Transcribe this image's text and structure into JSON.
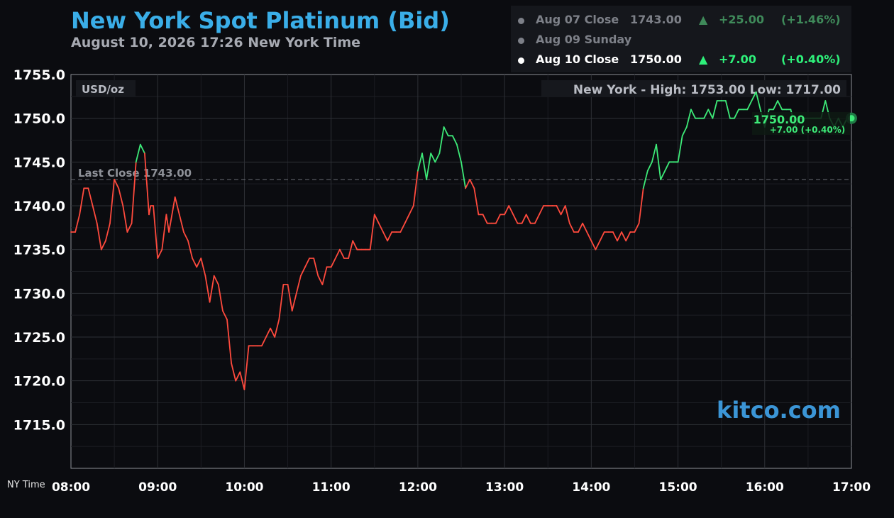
{
  "chart_data": {
    "type": "line",
    "title": "New York Spot Platinum (Bid)",
    "subtitle": "August 10, 2026 17:26 New York Time",
    "unit_label": "USD/oz",
    "stats_label": "New York - High: 1753.00   Low: 1717.00",
    "last_close_label": "Last Close 1743.00",
    "last_close": 1743.0,
    "current_value_label": "1750.00",
    "current_change_label": "+7.00 (+0.40%)",
    "current_value": 1750.0,
    "watermark": "kitco.com",
    "x_axis_caption": "NY Time",
    "xlim": [
      8,
      17
    ],
    "ylim": [
      1710,
      1755
    ],
    "x_ticks": [
      8,
      9,
      10,
      11,
      12,
      13,
      14,
      15,
      16,
      17
    ],
    "x_tick_labels": [
      "08:00",
      "09:00",
      "10:00",
      "11:00",
      "12:00",
      "13:00",
      "14:00",
      "15:00",
      "16:00",
      "17:00"
    ],
    "y_ticks": [
      1715,
      1720,
      1725,
      1730,
      1735,
      1740,
      1745,
      1750,
      1755
    ],
    "y_tick_labels": [
      "1715.0",
      "1720.0",
      "1725.0",
      "1730.0",
      "1735.0",
      "1740.0",
      "1745.0",
      "1750.0",
      "1755.0"
    ],
    "grid": true,
    "colors": {
      "below_close": "#ff4a3d",
      "above_close": "#3dea78",
      "title": "#3aaee8",
      "watermark": "#3b95d6",
      "grid": "#2e3036",
      "frame": "#8c8f96"
    },
    "series": [
      {
        "x": [
          8.0,
          8.05,
          8.1,
          8.15,
          8.2,
          8.25,
          8.3,
          8.35,
          8.4,
          8.45,
          8.5,
          8.55,
          8.6,
          8.65,
          8.7,
          8.75,
          8.8,
          8.85,
          8.9,
          8.92,
          8.95,
          9.0,
          9.05,
          9.1,
          9.13,
          9.2,
          9.25,
          9.3,
          9.35,
          9.4,
          9.45,
          9.5,
          9.55,
          9.6,
          9.65,
          9.7,
          9.75,
          9.8,
          9.85,
          9.9,
          9.95,
          10.0,
          10.05,
          10.1,
          10.15,
          10.2,
          10.25,
          10.3,
          10.35,
          10.4,
          10.45,
          10.5,
          10.55,
          10.6,
          10.65,
          10.7,
          10.75,
          10.8,
          10.85,
          10.9,
          10.95,
          11.0,
          11.05,
          11.1,
          11.15,
          11.2,
          11.25,
          11.3,
          11.35,
          11.4,
          11.45,
          11.5,
          11.55,
          11.6,
          11.65,
          11.7,
          11.75,
          11.8,
          11.85,
          11.9,
          11.95,
          12.0,
          12.05,
          12.1,
          12.15,
          12.2,
          12.25,
          12.3,
          12.35,
          12.4,
          12.45,
          12.5,
          12.55,
          12.6,
          12.65,
          12.7,
          12.75,
          12.8,
          12.85,
          12.9,
          12.95,
          13.0,
          13.05,
          13.1,
          13.15,
          13.2,
          13.25,
          13.3,
          13.35,
          13.4,
          13.45,
          13.5,
          13.55,
          13.6,
          13.65,
          13.7,
          13.75,
          13.8,
          13.85,
          13.9,
          13.95,
          14.0,
          14.05,
          14.1,
          14.15,
          14.2,
          14.25,
          14.3,
          14.35,
          14.4,
          14.45,
          14.5,
          14.55,
          14.6,
          14.65,
          14.7,
          14.75,
          14.8,
          14.85,
          14.9,
          14.95,
          15.0,
          15.05,
          15.1,
          15.15,
          15.2,
          15.25,
          15.3,
          15.35,
          15.4,
          15.45,
          15.5,
          15.55,
          15.6,
          15.65,
          15.7,
          15.75,
          15.8,
          15.85,
          15.9,
          15.95,
          16.0,
          16.05,
          16.1,
          16.15,
          16.2,
          16.25,
          16.3,
          16.35,
          16.4,
          16.45,
          16.5,
          16.55,
          16.6,
          16.65,
          16.7,
          16.75,
          16.8,
          16.85,
          16.9,
          16.95,
          17.0
        ],
        "y": [
          1737,
          1737,
          1739,
          1742,
          1742,
          1740,
          1738,
          1735,
          1736,
          1738,
          1743,
          1742,
          1740,
          1737,
          1738,
          1745,
          1747,
          1746,
          1739,
          1740,
          1740,
          1734,
          1735,
          1739,
          1737,
          1741,
          1739,
          1737,
          1736,
          1734,
          1733,
          1734,
          1732,
          1729,
          1732,
          1731,
          1728,
          1727,
          1722,
          1720,
          1721,
          1719,
          1724,
          1724,
          1724,
          1724,
          1725,
          1726,
          1725,
          1727,
          1731,
          1731,
          1728,
          1730,
          1732,
          1733,
          1734,
          1734,
          1732,
          1731,
          1733,
          1733,
          1734,
          1735,
          1734,
          1734,
          1736,
          1735,
          1735,
          1735,
          1735,
          1739,
          1738,
          1737,
          1736,
          1737,
          1737,
          1737,
          1738,
          1739,
          1740,
          1744,
          1746,
          1743,
          1746,
          1745,
          1746,
          1749,
          1748,
          1748,
          1747,
          1745,
          1742,
          1743,
          1742,
          1739,
          1739,
          1738,
          1738,
          1738,
          1739,
          1739,
          1740,
          1739,
          1738,
          1738,
          1739,
          1738,
          1738,
          1739,
          1740,
          1740,
          1740,
          1740,
          1739,
          1740,
          1738,
          1737,
          1737,
          1738,
          1737,
          1736,
          1735,
          1736,
          1737,
          1737,
          1737,
          1736,
          1737,
          1736,
          1737,
          1737,
          1738,
          1742,
          1744,
          1745,
          1747,
          1743,
          1744,
          1745,
          1745,
          1745,
          1748,
          1749,
          1751,
          1750,
          1750,
          1750,
          1751,
          1750,
          1752,
          1752,
          1752,
          1750,
          1750,
          1751,
          1751,
          1751,
          1752,
          1753,
          1751,
          1749,
          1751,
          1751,
          1752,
          1751,
          1751,
          1751,
          1749,
          1750,
          1750,
          1750,
          1750,
          1750,
          1750,
          1752,
          1750,
          1749,
          1750,
          1749,
          1750,
          1750
        ]
      }
    ]
  },
  "legend": [
    {
      "date_label": "Aug 07 Close",
      "price": "1743.00",
      "arrow": "▲",
      "change": "+25.00",
      "pct": "(+1.46%)",
      "state": "dim"
    },
    {
      "date_label": "Aug 09 Sunday",
      "price": "",
      "arrow": "",
      "change": "",
      "pct": "",
      "state": "dim"
    },
    {
      "date_label": "Aug 10 Close",
      "price": "1750.00",
      "arrow": "▲",
      "change": "+7.00",
      "pct": "(+0.40%)",
      "state": "active"
    }
  ]
}
